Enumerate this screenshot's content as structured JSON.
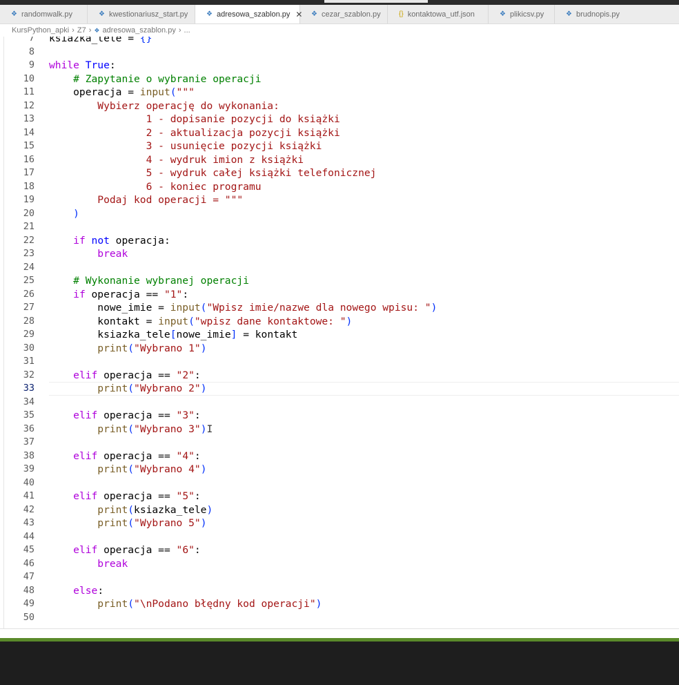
{
  "tabs": [
    {
      "label": "randomwalk.py",
      "icon": "python-icon"
    },
    {
      "label": "kwestionariusz_start.py",
      "icon": "python-icon"
    },
    {
      "label": "adresowa_szablon.py",
      "icon": "python-icon",
      "active": true
    },
    {
      "label": "cezar_szablon.py",
      "icon": "python-icon"
    },
    {
      "label": "kontaktowa_utf.json",
      "icon": "json-icon"
    },
    {
      "label": "plikicsv.py",
      "icon": "python-icon"
    },
    {
      "label": "brudnopis.py",
      "icon": "python-icon"
    }
  ],
  "breadcrumb": [
    "KursPython_apki",
    "Z7",
    "adresowa_szablon.py",
    "..."
  ],
  "editor": {
    "current_line": 33,
    "line_numbers": [
      "7",
      "8",
      "9",
      "10",
      "11",
      "12",
      "13",
      "14",
      "15",
      "16",
      "17",
      "18",
      "19",
      "20",
      "21",
      "22",
      "23",
      "24",
      "25",
      "26",
      "27",
      "28",
      "29",
      "30",
      "31",
      "32",
      "33",
      "34",
      "35",
      "36",
      "37",
      "38",
      "39",
      "40",
      "41",
      "42",
      "43",
      "44",
      "45",
      "46",
      "47",
      "48",
      "49",
      "50"
    ],
    "lines": [
      "ksiazka_tele = {}",
      "",
      "while True:",
      "    # Zapytanie o wybranie operacji",
      "    operacja = input(\"\"\"",
      "        Wybierz operację do wykonania:",
      "                1 - dopisanie pozycji do książki",
      "                2 - aktualizacja pozycji książki",
      "                3 - usunięcie pozycji książki",
      "                4 - wydruk imion z książki",
      "                5 - wydruk całej książki telefonicznej",
      "                6 - koniec programu",
      "        Podaj kod operacji = \"\"\"",
      "    )",
      "",
      "    if not operacja:",
      "        break",
      "",
      "    # Wykonanie wybranej operacji",
      "    if operacja == \"1\":",
      "        nowe_imie = input(\"Wpisz imie/nazwe dla nowego wpisu: \")",
      "        kontakt = input(\"wpisz dane kontaktowe: \")",
      "        ksiazka_tele[nowe_imie] = kontakt",
      "        print(\"Wybrano 1\")",
      "",
      "    elif operacja == \"2\":",
      "        print(\"Wybrano 2\")",
      "",
      "    elif operacja == \"3\":",
      "        print(\"Wybrano 3\")",
      "",
      "    elif operacja == \"4\":",
      "        print(\"Wybrano 4\")",
      "",
      "    elif operacja == \"5\":",
      "        print(ksiazka_tele)",
      "        print(\"Wybrano 5\")",
      "",
      "    elif operacja == \"6\":",
      "        break",
      "",
      "    else:",
      "        print(\"\\nPodano błędny kod operacji\")",
      ""
    ]
  }
}
